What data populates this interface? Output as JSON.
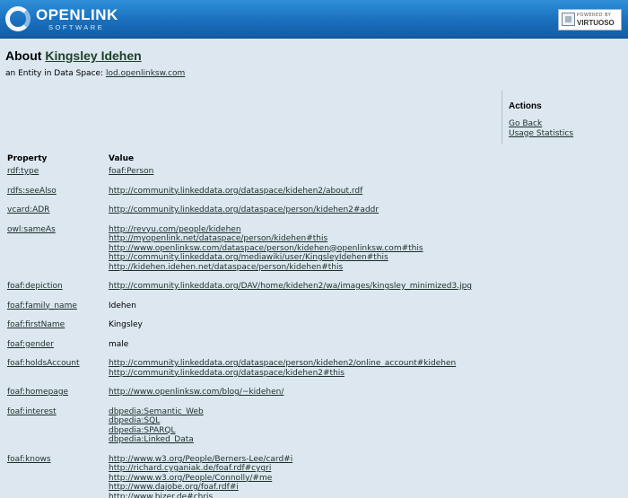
{
  "header": {
    "logo_main": "OPENLINK",
    "logo_sub": "SOFTWARE",
    "powered_top": "POWERED BY",
    "powered_name": "VIRTUOSO"
  },
  "page": {
    "about_prefix": "About",
    "entity_name": "Kingsley Idehen",
    "subtitle_prefix": "an Entity in Data Space:",
    "data_space": "lod.openlinksw.com"
  },
  "actions": {
    "title": "Actions",
    "go_back": "Go Back",
    "usage_statistics": "Usage Statistics"
  },
  "table": {
    "property_header": "Property",
    "value_header": "Value",
    "rows": [
      {
        "property": "rdf:type",
        "values": [
          "foaf:Person"
        ],
        "links": true
      },
      {
        "property": "rdfs:seeAlso",
        "values": [
          "http://community.linkeddata.org/dataspace/kidehen2/about.rdf"
        ],
        "links": true
      },
      {
        "property": "vcard:ADR",
        "values": [
          "http://community.linkeddata.org/dataspace/person/kidehen2#addr"
        ],
        "links": true
      },
      {
        "property": "owl:sameAs",
        "values": [
          "http://revyu.com/people/kidehen",
          "http://myopenlink.net/dataspace/person/kidehen#this",
          "http://www.openlinksw.com/dataspace/person/kidehen@openlinksw.com#this",
          "http://community.linkeddata.org/mediawiki/user/KingsleyIdehen#this",
          "http://kidehen.idehen.net/dataspace/person/kidehen#this"
        ],
        "links": true
      },
      {
        "property": "foaf:depiction",
        "values": [
          "http://community.linkeddata.org/DAV/home/kidehen2/wa/images/kingsley_minimized3.jpg"
        ],
        "links": true
      },
      {
        "property": "foaf:family_name",
        "values": [
          "Idehen"
        ],
        "links": false
      },
      {
        "property": "foaf:firstName",
        "values": [
          "Kingsley"
        ],
        "links": false
      },
      {
        "property": "foaf:gender",
        "values": [
          "male"
        ],
        "links": false
      },
      {
        "property": "foaf:holdsAccount",
        "values": [
          "http://community.linkeddata.org/dataspace/person/kidehen2/online_account#kidehen",
          "http://community.linkeddata.org/dataspace/kidehen2#this"
        ],
        "links": true
      },
      {
        "property": "foaf:homepage",
        "values": [
          "http://www.openlinksw.com/blog/~kidehen/"
        ],
        "links": true
      },
      {
        "property": "foaf:interest",
        "values": [
          "dbpedia:Semantic_Web",
          "dbpedia:SQL",
          "dbpedia:SPARQL",
          "dbpedia:Linked_Data"
        ],
        "links": true
      },
      {
        "property": "foaf:knows",
        "values": [
          "http://www.w3.org/People/Berners-Lee/card#i",
          "http://richard.cyganiak.de/foaf.rdf#cygri",
          "http://www.w3.org/People/Connolly/#me",
          "http://www.dajobe.org/foaf.rdf#i",
          "http://www.bizer.de#chris"
        ],
        "links": true
      }
    ]
  }
}
